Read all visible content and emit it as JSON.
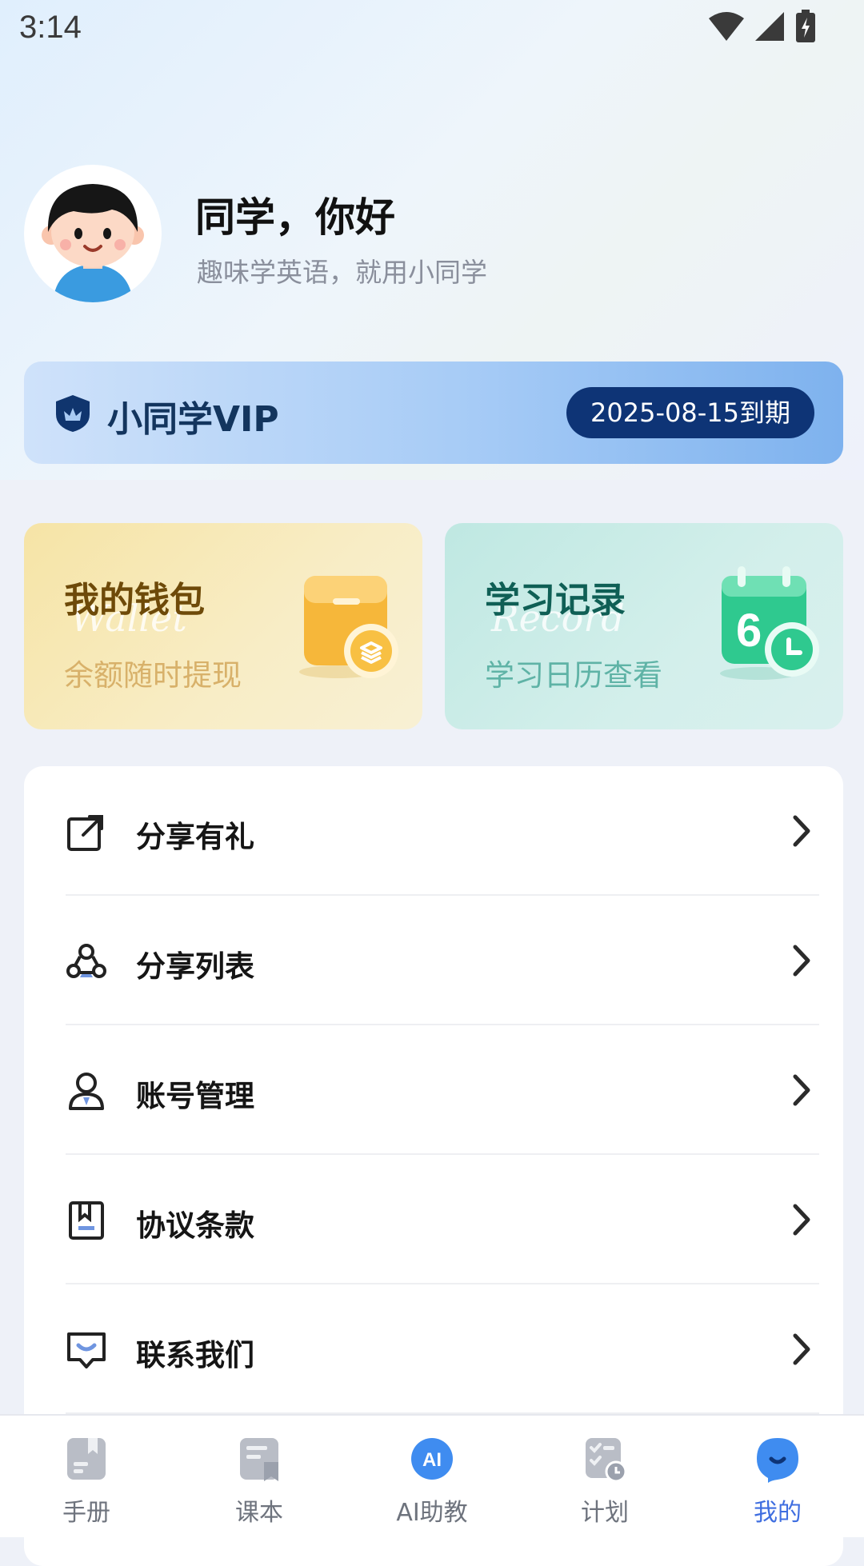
{
  "status_bar": {
    "time": "3:14"
  },
  "profile": {
    "greeting": "同学，你好",
    "subtitle": "趣味学英语，就用小同学"
  },
  "vip": {
    "title": "小同学VIP",
    "expiry": "2025-08-15到期"
  },
  "cards": {
    "wallet": {
      "title": "我的钱包",
      "script": "Wallet",
      "subtitle": "余额随时提现"
    },
    "record": {
      "title": "学习记录",
      "script": "Record",
      "subtitle": "学习日历查看"
    }
  },
  "menu": [
    {
      "label": "分享有礼",
      "icon": "share-icon"
    },
    {
      "label": "分享列表",
      "icon": "share-list-icon"
    },
    {
      "label": "账号管理",
      "icon": "account-icon"
    },
    {
      "label": "协议条款",
      "icon": "agreement-icon"
    },
    {
      "label": "联系我们",
      "icon": "contact-icon"
    }
  ],
  "tabs": [
    {
      "label": "手册",
      "icon": "handbook-icon"
    },
    {
      "label": "课本",
      "icon": "textbook-icon"
    },
    {
      "label": "AI助教",
      "icon": "ai-assistant-icon"
    },
    {
      "label": "计划",
      "icon": "plan-icon"
    },
    {
      "label": "我的",
      "icon": "profile-icon",
      "active": true
    }
  ],
  "colors": {
    "accent": "#3f6ee0",
    "vip_badge": "#0e3476",
    "wallet_card": "#f6e4a6",
    "record_card": "#bfe8e2"
  }
}
